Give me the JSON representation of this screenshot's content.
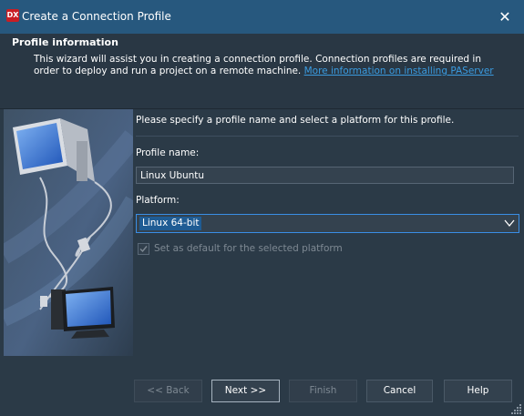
{
  "window": {
    "title": "Create a Connection Profile",
    "app_icon_text": "DX",
    "close_glyph": "✕"
  },
  "header": {
    "title": "Profile information",
    "description": "This wizard will assist you in creating a connection profile.  Connection profiles are required in order to deploy and run a project on a remote machine. ",
    "link": "More information on installing PAServer"
  },
  "form": {
    "intro": "Please specify a profile name and select a platform for this profile.",
    "profile_name_label": "Profile name:",
    "profile_name_value": "Linux Ubuntu",
    "platform_label": "Platform:",
    "platform_value": "Linux 64-bit",
    "default_checkbox_label": "Set as default for the selected platform",
    "default_checked": true
  },
  "buttons": {
    "back": "<< Back",
    "next": "Next >>",
    "finish": "Finish",
    "cancel": "Cancel",
    "help": "Help"
  },
  "colors": {
    "titlebar": "#27587e",
    "background": "#2b3a47",
    "link": "#3a9be0",
    "focus": "#3a8ee6"
  }
}
